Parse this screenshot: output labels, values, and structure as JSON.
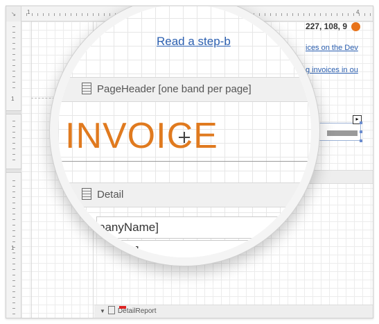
{
  "ruler": {
    "top_labels": [
      "1",
      "4"
    ],
    "left_labels": [
      "1",
      "1"
    ]
  },
  "background": {
    "links": [
      "Read a step-by-",
      "ices on the Dev",
      "g invoices in ou"
    ],
    "bands": {
      "detail_report": "DetailReport"
    },
    "selected_control_tag": "▸"
  },
  "magnifier": {
    "link_text": "Read a step-b",
    "page_header_band": "PageHeader [one band per page]",
    "invoice_title": "INVOICE",
    "detail_band": "Detail",
    "field_company": "panyName]",
    "field_name": "[Sh    me]"
  },
  "coords": {
    "text": "227, 108, 9",
    "color": "#e8731a"
  },
  "colors": {
    "accent_orange": "#e07a1f",
    "link_blue": "#2b5fb0"
  }
}
